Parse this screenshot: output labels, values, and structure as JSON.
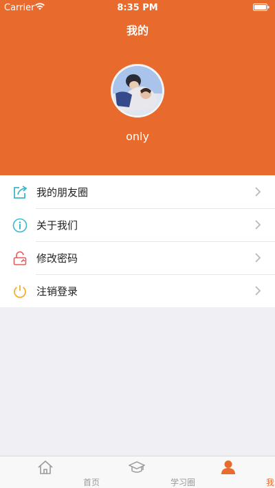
{
  "status_bar": {
    "carrier": "Carrier",
    "time": "8:35 PM"
  },
  "header": {
    "title": "我的",
    "username": "only",
    "bg_color": "#e86a2c"
  },
  "menu": [
    {
      "label": "我的朋友圈",
      "icon": "share-edit-icon",
      "icon_color": "#3bb8c8"
    },
    {
      "label": "关于我们",
      "icon": "info-icon",
      "icon_color": "#3bb8c8"
    },
    {
      "label": "修改密码",
      "icon": "lock-icon",
      "icon_color": "#e85a5a"
    },
    {
      "label": "注销登录",
      "icon": "power-icon",
      "icon_color": "#f0b030"
    }
  ],
  "tabbar": {
    "tabs": [
      {
        "label": "首页",
        "icon": "home-icon",
        "active": false
      },
      {
        "label": "学习圈",
        "icon": "graduation-cap-icon",
        "active": false
      },
      {
        "label": "我的",
        "icon": "user-icon",
        "active": true
      }
    ],
    "active_color": "#e86a2c"
  }
}
